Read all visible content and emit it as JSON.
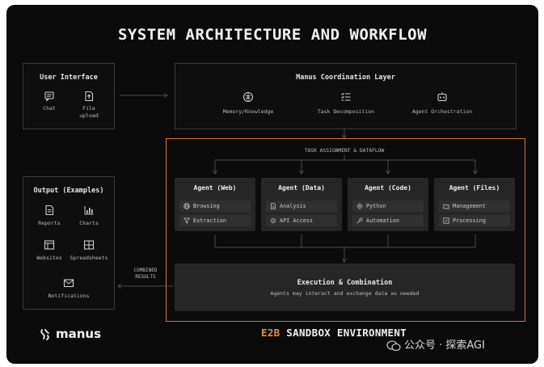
{
  "title": "SYSTEM ARCHITECTURE AND WORKFLOW",
  "user_interface": {
    "title": "User Interface",
    "items": [
      {
        "label": "Chat",
        "icon": "chat-icon"
      },
      {
        "label": "File\nupload",
        "icon": "file-upload-icon"
      }
    ]
  },
  "coordination": {
    "title": "Manus Coordination Layer",
    "items": [
      {
        "label": "Memory/Knowledge",
        "icon": "brain-icon"
      },
      {
        "label": "Task Decomposition",
        "icon": "list-check-icon"
      },
      {
        "label": "Agent Orchestration",
        "icon": "robot-icon"
      }
    ]
  },
  "dataflow_label": "TASK ASSIGNMENT & DATAFLOW",
  "agents": [
    {
      "name": "Agent (Web)",
      "tasks": [
        {
          "label": "Browsing",
          "icon": "globe-icon"
        },
        {
          "label": "Extraction",
          "icon": "filter-icon"
        }
      ]
    },
    {
      "name": "Agent (Data)",
      "tasks": [
        {
          "label": "Analysis",
          "icon": "document-icon"
        },
        {
          "label": "API Access",
          "icon": "plug-icon"
        }
      ]
    },
    {
      "name": "Agent (Code)",
      "tasks": [
        {
          "label": "Python",
          "icon": "python-icon"
        },
        {
          "label": "Automation",
          "icon": "wrench-icon"
        }
      ]
    },
    {
      "name": "Agent (Files)",
      "tasks": [
        {
          "label": "Management",
          "icon": "folder-icon"
        },
        {
          "label": "Processing",
          "icon": "process-icon"
        }
      ]
    }
  ],
  "execution": {
    "title": "Execution & Combination",
    "subtitle": "Agents may interact and exchange data as needed"
  },
  "combined_results": "COMBINED\nRESULTS",
  "output": {
    "title": "Output (Examples)",
    "items": [
      {
        "label": "Reports",
        "icon": "report-icon"
      },
      {
        "label": "Charts",
        "icon": "chart-icon"
      },
      {
        "label": "Websites",
        "icon": "website-icon"
      },
      {
        "label": "Spreadsheets",
        "icon": "spreadsheet-icon"
      },
      {
        "label": "Notifications",
        "icon": "mail-icon"
      }
    ]
  },
  "footer": {
    "logo_text": "manus",
    "sandbox_prefix": "E2B",
    "sandbox_rest": " SANDBOX ENVIRONMENT",
    "watermark": "公众号 · 探索AGI"
  },
  "colors": {
    "accent": "#d9733b",
    "background": "#0b0b0b",
    "card": "#262626"
  }
}
